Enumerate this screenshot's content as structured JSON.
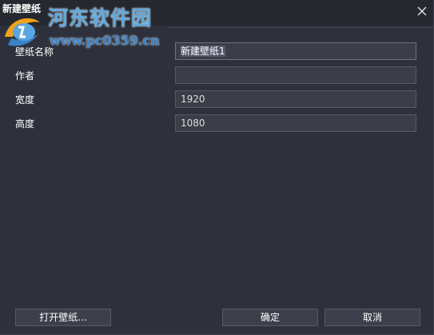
{
  "window": {
    "title": "新建壁纸",
    "close_icon": "close-icon"
  },
  "watermark": {
    "site_name": "河东软件园",
    "site_url": "www.pc0359.cn",
    "logo_icon": "site-logo-icon"
  },
  "form": {
    "fields": [
      {
        "label": "壁纸名称",
        "value": "新建壁纸1"
      },
      {
        "label": "作者",
        "value": ""
      },
      {
        "label": "宽度",
        "value": "1920"
      },
      {
        "label": "高度",
        "value": "1080"
      }
    ]
  },
  "buttons": {
    "open": "打开壁纸...",
    "ok": "确定",
    "cancel": "取消"
  },
  "colors": {
    "background": "#2e313b",
    "titlebar": "#262830",
    "input_bg": "#3b3e48",
    "input_border": "#555966",
    "watermark_blue": "#3a82c9"
  }
}
